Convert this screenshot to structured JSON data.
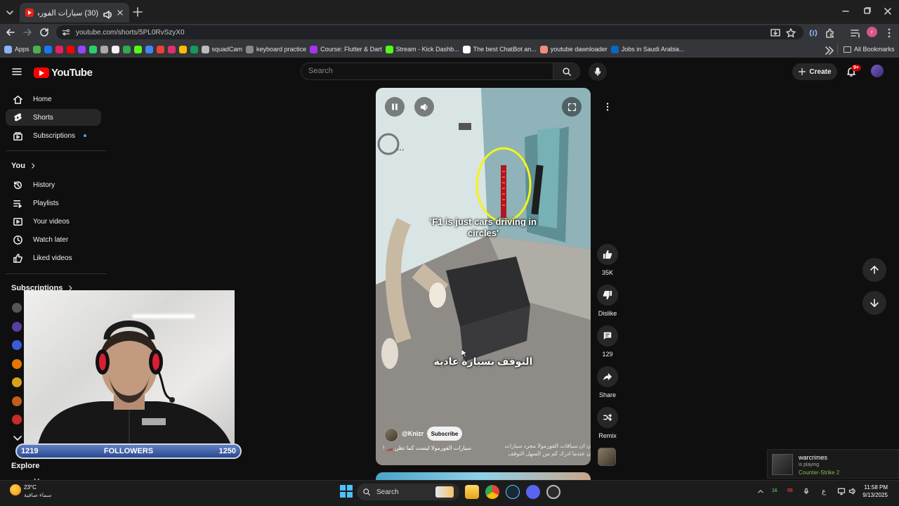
{
  "browser": {
    "tab_title": "(30) سيارات الفورمولا ليست",
    "url": "youtube.com/shorts/5PL0RvSzyX0",
    "new_tab": "+"
  },
  "bookmarks": [
    {
      "label": "Apps",
      "color": "#8ab4f8"
    },
    {
      "label": "",
      "color": "#4caf50"
    },
    {
      "label": "",
      "color": "#1877f2"
    },
    {
      "label": "",
      "color": "#e91e63"
    },
    {
      "label": "",
      "color": "#ff0000"
    },
    {
      "label": "",
      "color": "#9146ff"
    },
    {
      "label": "",
      "color": "#25d366"
    },
    {
      "label": "",
      "color": "#aaaaaa"
    },
    {
      "label": "",
      "color": "#f1f1f1"
    },
    {
      "label": "",
      "color": "#34a853"
    },
    {
      "label": "",
      "color": "#53fc18"
    },
    {
      "label": "",
      "color": "#4285f4"
    },
    {
      "label": "",
      "color": "#ea4335"
    },
    {
      "label": "",
      "color": "#e1306c"
    },
    {
      "label": "",
      "color": "#fbbc05"
    },
    {
      "label": "",
      "color": "#0f9d58"
    },
    {
      "label": "squadCam",
      "color": "#bbbbbb"
    },
    {
      "label": "keyboard practice",
      "color": "#888888"
    },
    {
      "label": "Course: Flutter & Dart",
      "color": "#a435f0"
    },
    {
      "label": "Stream - Kick Dashb...",
      "color": "#53fc18"
    },
    {
      "label": "The best ChatBot an...",
      "color": "#ffffff"
    },
    {
      "label": "youtube dawnloader",
      "color": "#f28b82"
    },
    {
      "label": "Jobs in Saudi Arabia...",
      "color": "#0a66c2"
    }
  ],
  "bookmarks_all": "All Bookmarks",
  "youtube": {
    "logo": "YouTube",
    "search_placeholder": "Search",
    "create": "Create",
    "notif_badge": "9+"
  },
  "sidebar": {
    "main": [
      {
        "label": "Home",
        "icon": "home-icon"
      },
      {
        "label": "Shorts",
        "icon": "shorts-icon",
        "active": true
      },
      {
        "label": "Subscriptions",
        "icon": "subscriptions-icon"
      }
    ],
    "you_heading": "You",
    "you": [
      {
        "label": "History",
        "icon": "history-icon"
      },
      {
        "label": "Playlists",
        "icon": "playlists-icon"
      },
      {
        "label": "Your videos",
        "icon": "your-videos-icon"
      },
      {
        "label": "Watch later",
        "icon": "watch-later-icon"
      },
      {
        "label": "Liked videos",
        "icon": "liked-videos-icon"
      }
    ],
    "subs_heading": "Subscriptions",
    "sub_colors": [
      "#555555",
      "#5a3fa0",
      "#3b5bdb",
      "#e67700",
      "#d9a11b",
      "#c45c1c",
      "#c92a2a"
    ],
    "explore": "Explore",
    "cutoff": "M"
  },
  "stream_overlay": {
    "followers_current": "1219",
    "followers_label": "FOLLOWERS",
    "followers_goal": "1250"
  },
  "short": {
    "caption_top": "'F1 is just cars driving in circles'",
    "caption_ar": "التوقف بسيارة عادية",
    "channel": "@Knizr",
    "subscribe": "Subscribe",
    "title": "سيارات الفورمولا ليست كما تظن 🏎️ !",
    "desc_line1": "ن ان سباقات الفورمولا مجرد سيارات",
    "desc_line2": "ن عندما ادرك كم من السهل التوقف"
  },
  "actions": {
    "likes": "35K",
    "dislike": "Dislike",
    "comments": "129",
    "share": "Share",
    "remix": "Remix"
  },
  "notification": {
    "name": "warcrimes",
    "status": "is playing",
    "game": "Counter-Strike 2"
  },
  "taskbar": {
    "temp": "23°C",
    "weather": "سماء صافية",
    "search": "Search",
    "lang": "ع",
    "net_up": "16",
    "net_down": "55",
    "time": "11:58 PM",
    "date": "9/13/2025"
  }
}
